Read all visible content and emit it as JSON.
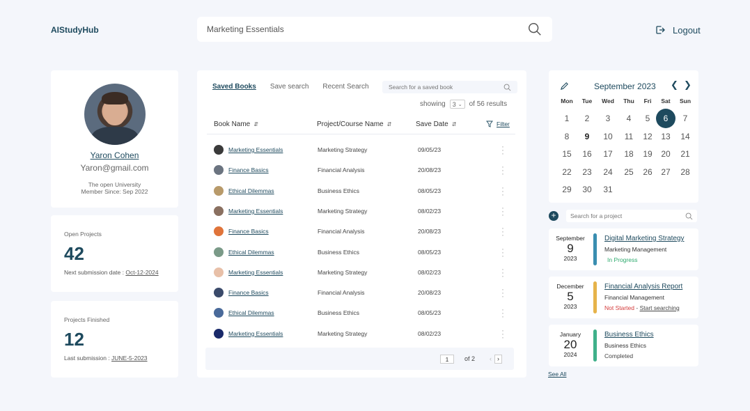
{
  "header": {
    "logo": "AIStudyHub",
    "search_value": "Marketing Essentials",
    "logout_label": "Logout"
  },
  "profile": {
    "name": "Yaron Cohen",
    "email": "Yaron@gmail.com",
    "university": "The open University",
    "member_since": "Member Since: Sep 2022"
  },
  "open_projects": {
    "label": "Open Projects",
    "count": "42",
    "sub_label": "Next submission date : ",
    "sub_value": "Oct-12-2024"
  },
  "projects_finished": {
    "label": "Projects Finished",
    "count": "12",
    "sub_label": "Last submission : ",
    "sub_value": "JUNE-5-2023"
  },
  "books": {
    "tabs": [
      "Saved Books",
      "Save search",
      "Recent Search"
    ],
    "search_placeholder": "Search for a saved book",
    "showing_label": "showing",
    "showing_value": "3",
    "results_label": "of 56 results",
    "columns": {
      "book": "Book Name",
      "project": "Project/Course Name",
      "date": "Save Date",
      "filter": "Filter"
    },
    "rows": [
      {
        "name": "Marketing Essentials",
        "project": "Marketing Strategy",
        "date": "09/05/23",
        "thumb": "#3a3a3a"
      },
      {
        "name": "Finance Basics",
        "project": "Financial Analysis",
        "date": "20/08/23",
        "thumb": "#6b7480"
      },
      {
        "name": "Ethical Dilemmas",
        "project": "Business Ethics",
        "date": "08/05/23",
        "thumb": "#b89a6a"
      },
      {
        "name": "Marketing Essentials",
        "project": "Marketing Strategy",
        "date": "08/02/23",
        "thumb": "#8a7060"
      },
      {
        "name": "Finance Basics",
        "project": "Financial Analysis",
        "date": "20/08/23",
        "thumb": "#e0743a"
      },
      {
        "name": "Ethical Dilemmas",
        "project": "Business Ethics",
        "date": "08/05/23",
        "thumb": "#7a9a88"
      },
      {
        "name": "Marketing Essentials",
        "project": "Marketing Strategy",
        "date": "08/02/23",
        "thumb": "#e8c0a8"
      },
      {
        "name": "Finance Basics",
        "project": "Financial Analysis",
        "date": "20/08/23",
        "thumb": "#3a4a6a"
      },
      {
        "name": "Ethical Dilemmas",
        "project": "Business Ethics",
        "date": "08/05/23",
        "thumb": "#4a6a9a"
      },
      {
        "name": "Marketing Essentials",
        "project": "Marketing Strategy",
        "date": "08/02/23",
        "thumb": "#1a2a6a"
      }
    ],
    "pager": {
      "page": "1",
      "of": "of  2"
    }
  },
  "calendar": {
    "month": "September 2023",
    "dow": [
      "Mon",
      "Tue",
      "Wed",
      "Thu",
      "Fri",
      "Sat",
      "Sun"
    ],
    "weeks": [
      [
        "1",
        "2",
        "3",
        "4",
        "5",
        "6",
        "7"
      ],
      [
        "8",
        "9",
        "10",
        "11",
        "12",
        "13",
        "14"
      ],
      [
        "15",
        "16",
        "17",
        "18",
        "19",
        "20",
        "21"
      ],
      [
        "22",
        "23",
        "24",
        "25",
        "26",
        "27",
        "28"
      ],
      [
        "29",
        "30",
        "31"
      ]
    ],
    "today": "6",
    "bold": "9"
  },
  "projects": {
    "search_placeholder": "Search for a project",
    "items": [
      {
        "month": "September",
        "day": "9",
        "year": "2023",
        "title": "Digital Marketing Strategy",
        "course": "Marketing Management",
        "status": "In Progress",
        "status_color": "#2eaa6e",
        "bar_color": "#3a8eb0",
        "extra": ""
      },
      {
        "month": "December",
        "day": "5",
        "year": "2023",
        "title": "Financial Analysis Report",
        "course": "Financial Management",
        "status": "Not Started",
        "status_color": "#d33a3a",
        "bar_color": "#e6b34a",
        "extra": "Start searching"
      },
      {
        "month": "January",
        "day": "20",
        "year": "2024",
        "title": "Business Ethics",
        "course": "Business Ethics",
        "status": "Completed",
        "status_color": "#444444",
        "bar_color": "#3fb08a",
        "extra": ""
      }
    ],
    "see_all": "See All"
  }
}
